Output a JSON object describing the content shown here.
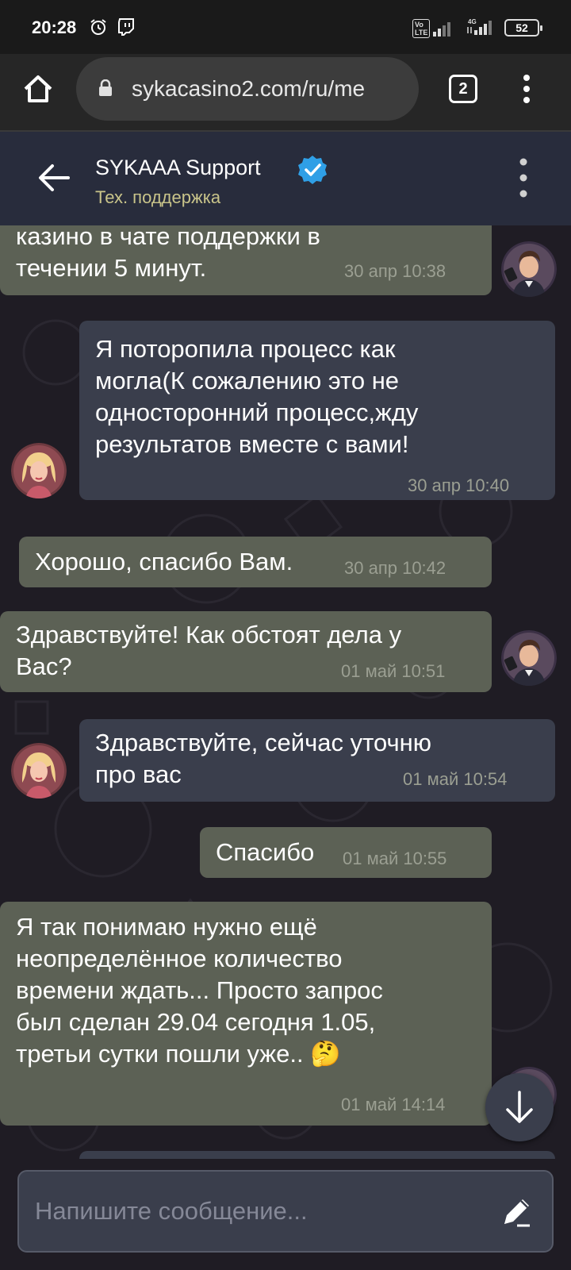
{
  "status_bar": {
    "time": "20:28",
    "volte": "Vo\nLTE",
    "battery": "52",
    "network": "4G"
  },
  "browser": {
    "url": "sykacasino2.com/ru/me",
    "tab_count": "2"
  },
  "chat_header": {
    "title": "SYKAAA Support",
    "subtitle": "Тех. поддержка",
    "accent_color": "#2f9fe6"
  },
  "messages": [
    {
      "side": "left",
      "text": "казино в чате поддержки в\nтечении 5 минут.",
      "time": "30 апр 10:38",
      "avatar": "agent-male-avatar"
    },
    {
      "side": "right",
      "text": "Я поторопила процесс как\nмогла(К сожалению это не\nодносторонний процесс,жду\nрезультатов вместе с вами!",
      "time": "30 апр 10:40",
      "avatar": "support-female-avatar"
    },
    {
      "side": "left",
      "text": "Хорошо, спасибо Вам.",
      "time": "30 апр 10:42"
    },
    {
      "side": "left",
      "text": "Здравствуйте! Как обстоят дела у\nВас?",
      "time": "01 май 10:51",
      "avatar": "agent-male-avatar"
    },
    {
      "side": "right",
      "text": "Здравствуйте, сейчас уточню\nпро вас",
      "time": "01 май 10:54",
      "avatar": "support-female-avatar"
    },
    {
      "side": "left",
      "text": "Спасибо",
      "time": "01 май 10:55"
    },
    {
      "side": "left",
      "text": "Я так понимаю нужно ещё\nнеопределённое количество\nвремени ждать... Просто запрос\nбыл сделан 29.04 сегодня 1.05,\nтретьи сутки  пошли уже.. 🤔",
      "time": "01 май 14:14",
      "avatar": "agent-male-avatar"
    }
  ],
  "input": {
    "placeholder": "Напишите сообщение..."
  }
}
